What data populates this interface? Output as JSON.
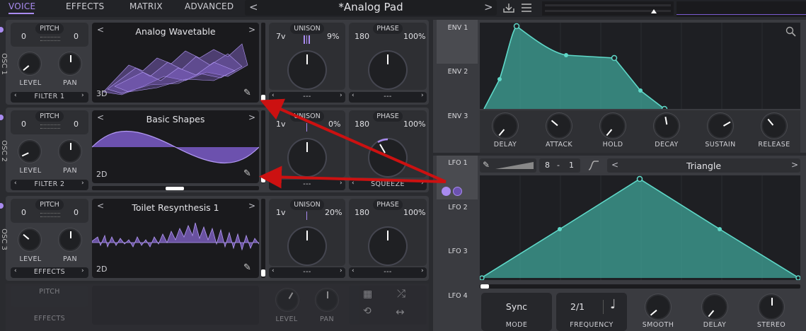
{
  "nav": {
    "voice": "VOICE",
    "effects": "EFFECTS",
    "matrix": "MATRIX",
    "advanced": "ADVANCED"
  },
  "preset": {
    "name": "*Analog Pad",
    "prev": "<",
    "next": ">"
  },
  "osc1": {
    "side_label": "OSC 1",
    "pitch_label": "PITCH",
    "pitch_left": "0",
    "pitch_right": "0",
    "level_label": "LEVEL",
    "pan_label": "PAN",
    "route": "FILTER 1",
    "wavetable": "Analog Wavetable",
    "dim": "3D",
    "unison_label": "UNISON",
    "voices": "7v",
    "unison_pct": "9%",
    "phase_label": "PHASE",
    "phase_val": "180",
    "phase_pct": "100%",
    "dest_a": "---",
    "dest_b": "---"
  },
  "osc2": {
    "side_label": "OSC 2",
    "pitch_label": "PITCH",
    "pitch_left": "0",
    "pitch_right": "0",
    "level_label": "LEVEL",
    "pan_label": "PAN",
    "route": "FILTER 2",
    "wavetable": "Basic Shapes",
    "dim": "2D",
    "unison_label": "UNISON",
    "voices": "1v",
    "unison_pct": "0%",
    "phase_label": "PHASE",
    "phase_val": "180",
    "phase_pct": "100%",
    "dest_a": "---",
    "dest_b": "SQUEEZE"
  },
  "osc3": {
    "side_label": "OSC 3",
    "pitch_label": "PITCH",
    "pitch_left": "0",
    "pitch_right": "0",
    "level_label": "LEVEL",
    "pan_label": "PAN",
    "route": "EFFECTS",
    "wavetable": "Toilet Resynthesis 1",
    "dim": "2D",
    "unison_label": "UNISON",
    "voices": "1v",
    "unison_pct": "20%",
    "phase_label": "PHASE",
    "phase_val": "180",
    "phase_pct": "100%",
    "dest_a": "---",
    "dest_b": "---"
  },
  "sampler": {
    "pitch_label": "PITCH",
    "route": "EFFECTS",
    "level_label": "LEVEL",
    "pan_label": "PAN"
  },
  "env_tabs": [
    "ENV 1",
    "ENV 2",
    "ENV 3"
  ],
  "env_knobs": [
    "DELAY",
    "ATTACK",
    "HOLD",
    "DECAY",
    "SUSTAIN",
    "RELEASE"
  ],
  "lfo_tabs": [
    "LFO 1",
    "LFO 2",
    "LFO 3",
    "LFO 4"
  ],
  "lfo": {
    "rate": "8",
    "sep": "-",
    "div": "1",
    "shape": "Triangle",
    "mode_val": "Sync",
    "freq_val": "2/1",
    "mode_label": "MODE",
    "freq_label": "FREQUENCY",
    "smooth_label": "SMOOTH",
    "delay_label": "DELAY",
    "stereo_label": "STEREO"
  },
  "colors": {
    "accent": "#a98bf0",
    "teal": "#5fd8c8",
    "red_annotation": "#cc1111"
  }
}
